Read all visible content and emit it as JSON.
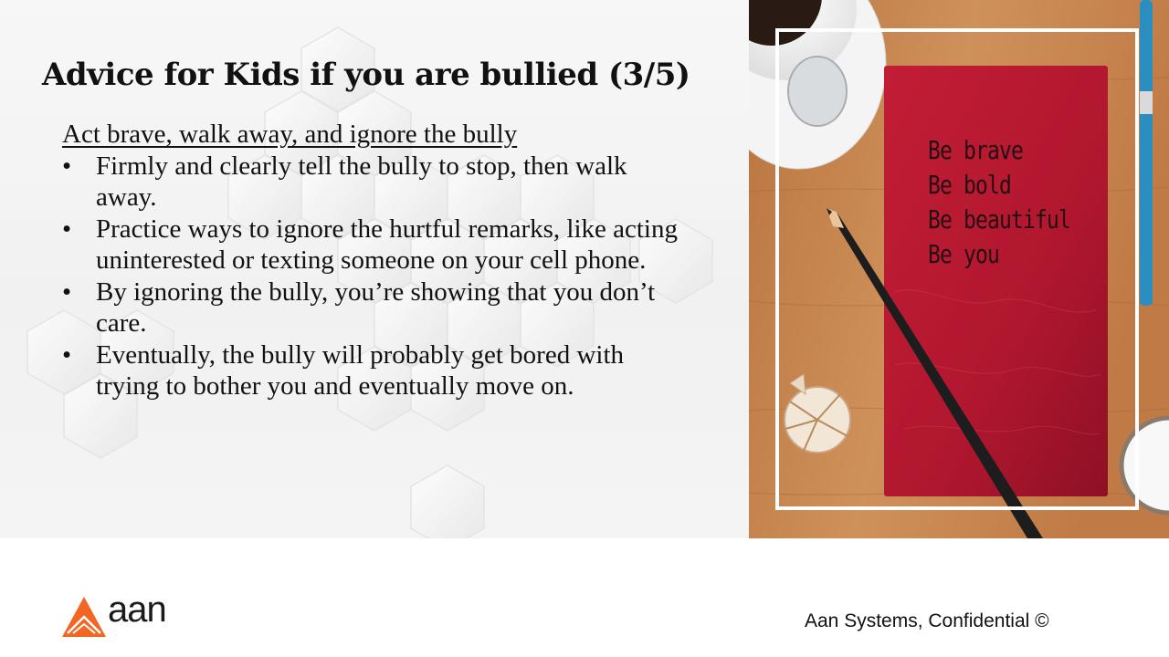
{
  "slide": {
    "title": "Advice for Kids if you are bullied (3/5)",
    "subheading": "Act brave, walk away, and ignore the bully",
    "bullet_symbol": "•",
    "bullets": [
      "Firmly and clearly tell the bully to stop, then walk away.",
      "Practice ways to ignore the hurtful remarks, like acting uninterested or texting someone on your cell phone.",
      "By ignoring the bully, you’re showing that you don’t care.",
      "Eventually, the bully will probably get bored with trying to bother you and eventually move on."
    ]
  },
  "photo": {
    "notebook_lines": [
      "Be brave",
      "Be bold",
      "Be beautiful",
      "Be you"
    ],
    "notebook_color": "#b3192f",
    "wood_color": "#c8864f"
  },
  "footer": {
    "logo_text": "aan",
    "logo_icon": "orange-triangle-logo-icon",
    "logo_color": "#f26522",
    "confidential": "Aan Systems, Confidential ©"
  }
}
